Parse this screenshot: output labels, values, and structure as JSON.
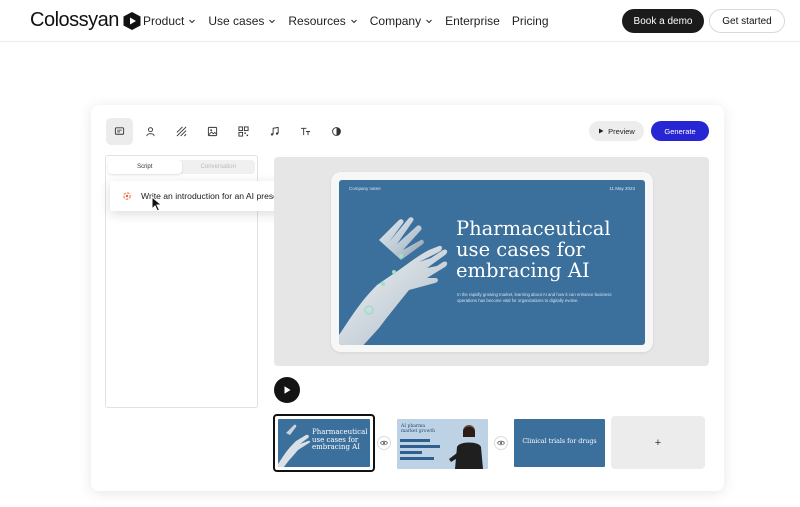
{
  "nav": {
    "logo_text": "Colossyan",
    "items": [
      {
        "label": "Product",
        "has_dropdown": true
      },
      {
        "label": "Use cases",
        "has_dropdown": true
      },
      {
        "label": "Resources",
        "has_dropdown": true
      },
      {
        "label": "Company",
        "has_dropdown": true
      },
      {
        "label": "Enterprise",
        "has_dropdown": false
      },
      {
        "label": "Pricing",
        "has_dropdown": false
      }
    ],
    "book_demo": "Book a demo",
    "get_started": "Get started"
  },
  "editor": {
    "toolbar_icons": [
      "text-icon",
      "person-icon",
      "stripes-icon",
      "image-icon",
      "qr-icon",
      "music-icon",
      "font-size-icon",
      "shape-icon"
    ],
    "preview_label": "Preview",
    "generate_label": "Generate",
    "tabs": [
      {
        "label": "Script",
        "active": true
      },
      {
        "label": "Conversation",
        "active": false
      }
    ],
    "prompt_text": "Write an introduction for an AI presentation",
    "slide": {
      "company": "Company name",
      "date": "11 May 2023",
      "title": "Pharmaceutical use cases for embracing AI",
      "body": "In the rapidly growing market, learning about AI and how it can enhance business operations has become vital for organizations to digitally evolve."
    },
    "thumbnails": [
      {
        "title": "Pharmaceutical use cases for embracing AI",
        "selected": true
      },
      {
        "title": "AI pharma market growth",
        "selected": false
      },
      {
        "title": "Clinical trials for drugs",
        "selected": false
      }
    ],
    "add_label": "+"
  },
  "colors": {
    "accent": "#2826d3",
    "slide_blue": "#3b6f9c",
    "dark": "#1b1b1b"
  }
}
